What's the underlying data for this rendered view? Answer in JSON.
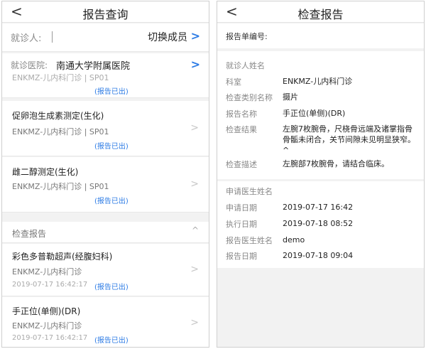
{
  "left": {
    "header": {
      "back": "<",
      "title": "报告查询"
    },
    "patient": {
      "label": "就诊人:",
      "switch_label": "切换成员",
      "chevron": ">"
    },
    "hospital": {
      "label": "就诊医院:",
      "value": "南通大学附属医院",
      "chevron": ">"
    },
    "partial_card": {
      "sub": "ENKMZ-儿内科门诊 | SP01",
      "status": "(报告已出)"
    },
    "lab_cards": [
      {
        "name": "促卵泡生成素测定(生化)",
        "sub": "ENKMZ-儿内科门诊 | SP01",
        "status": "(报告已出)",
        "chevron": ">"
      },
      {
        "name": "雌二醇测定(生化)",
        "sub": "ENKMZ-儿内科门诊 | SP01",
        "status": "(报告已出)",
        "chevron": ">"
      }
    ],
    "exam_section": {
      "label": "检查报告",
      "caret": "^"
    },
    "exam_cards": [
      {
        "name": "彩色多普勒超声(经腹妇科)",
        "sub": "ENKMZ-儿内科门诊",
        "date": "2019-07-17 16:42:17",
        "status": "(报告已出)",
        "chevron": ">"
      },
      {
        "name": "手正位(单侧)(DR)",
        "sub": "ENKMZ-儿内科门诊",
        "date": "2019-07-17 16:42:17",
        "status": "(报告已出)",
        "chevron": ">"
      }
    ]
  },
  "right": {
    "header": {
      "back": "<",
      "title": "检查报告"
    },
    "report_no_label": "报告单编号:",
    "patient_name_label": "就诊人姓名",
    "details": [
      {
        "k": "科室",
        "v": "ENKMZ-儿内科门诊"
      },
      {
        "k": "检查类别名称",
        "v": "摄片"
      },
      {
        "k": "报告名称",
        "v": "手正位(单侧)(DR)"
      },
      {
        "k": "检查结果",
        "v": "左腕7枚腕骨，尺桡骨远端及诸掌指骨骨骺未闭合，关节间隙未见明显狭窄。^"
      },
      {
        "k": "检查描述",
        "v": "左腕部7枚腕骨，请结合临床。"
      }
    ],
    "doctor_label": "申请医生姓名",
    "dates": [
      {
        "k": "申请日期",
        "v": "2019-07-17 16:42"
      },
      {
        "k": "执行日期",
        "v": "2019-07-18 08:52"
      },
      {
        "k": "报告医生姓名",
        "v": "demo"
      },
      {
        "k": "报告日期",
        "v": "2019-07-18 09:04"
      }
    ]
  }
}
